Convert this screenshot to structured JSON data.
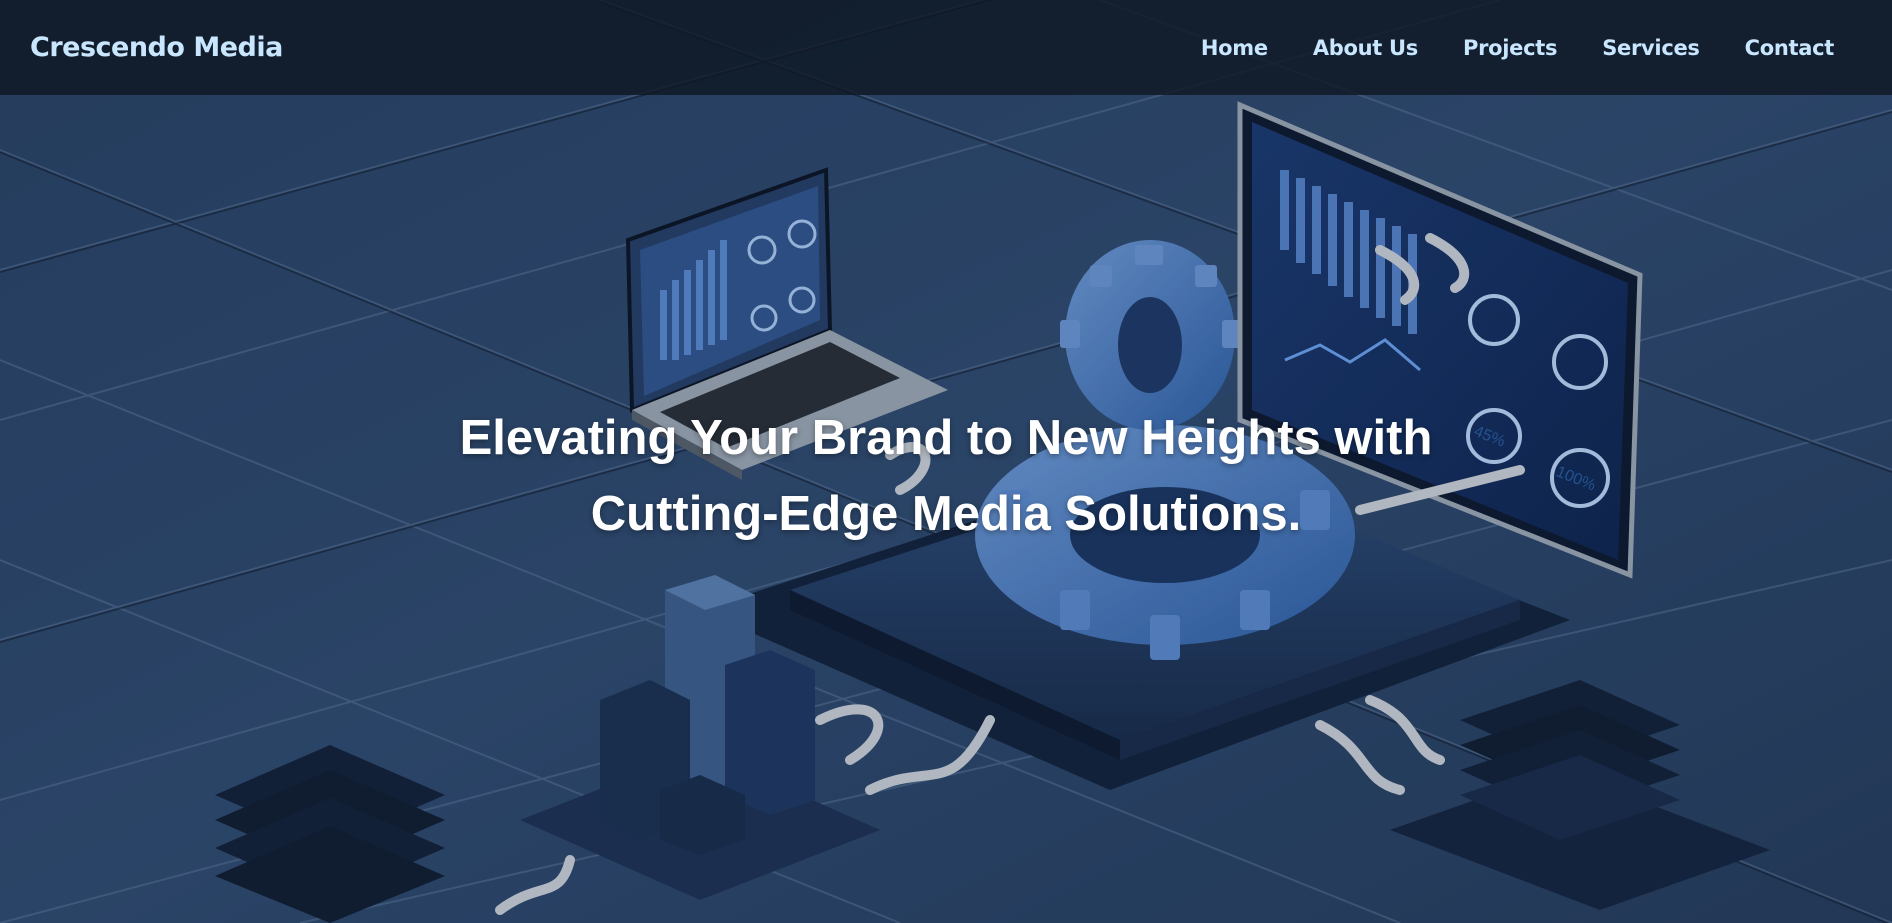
{
  "header": {
    "brand": "Crescendo Media",
    "nav": [
      {
        "label": "Home"
      },
      {
        "label": "About Us"
      },
      {
        "label": "Projects"
      },
      {
        "label": "Services"
      },
      {
        "label": "Contact"
      }
    ]
  },
  "hero": {
    "headline_line1": "Elevating Your Brand to New Heights with",
    "headline_line2": "Cutting-Edge Media Solutions.",
    "screen_labels": {
      "dial_1": "45%",
      "dial_2": "100%"
    }
  },
  "colors": {
    "nav_text": "#c9e6ff",
    "headline": "#ffffff",
    "background": "#2d4466",
    "accent_blue": "#3f74b8"
  }
}
